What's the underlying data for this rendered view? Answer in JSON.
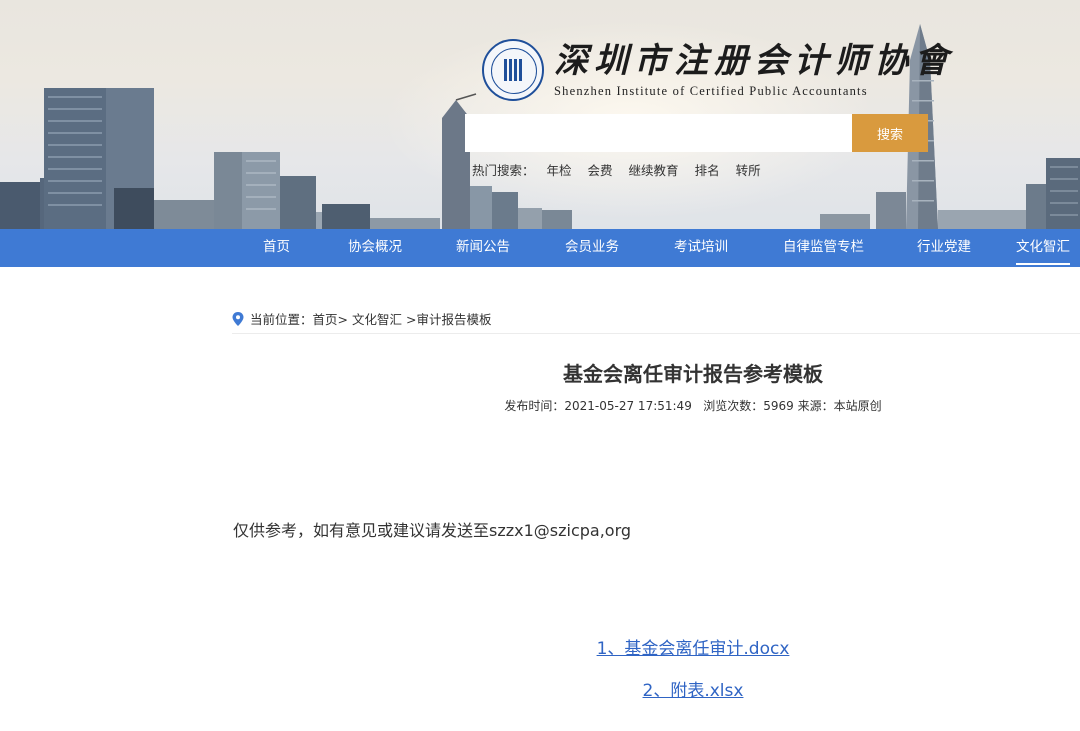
{
  "header": {
    "logo_cn": "深圳市注册会计师协會",
    "logo_en": "Shenzhen Institute of Certified Public Accountants",
    "search": {
      "placeholder": "",
      "button_label": "搜索"
    },
    "hot_search": {
      "label": "热门搜索：",
      "items": [
        "年检",
        "会费",
        "继续教育",
        "排名",
        "转所"
      ]
    }
  },
  "nav": {
    "items": [
      "首页",
      "协会概况",
      "新闻公告",
      "会员业务",
      "考试培训",
      "自律监管专栏",
      "行业党建",
      "文化智汇"
    ],
    "active": "文化智汇"
  },
  "breadcrumb": {
    "prefix": "当前位置：",
    "items": [
      "首页>",
      "文化智汇",
      ">审计报告模板"
    ]
  },
  "article": {
    "title": "基金会离任审计报告参考模板",
    "meta": "发布时间：2021-05-27 17:51:49   浏览次数：5969 来源：本站原创",
    "paragraph": "仅供参考，如有意见或建议请发送至szzx1@szicpa,org",
    "attachments": [
      "1、基金会离任审计.docx",
      "2、附表.xlsx"
    ]
  },
  "colors": {
    "nav_bg": "#3f7ad4",
    "search_button": "#d99a3e",
    "link": "#2f64c4",
    "logo_blue": "#1f4f9a"
  }
}
